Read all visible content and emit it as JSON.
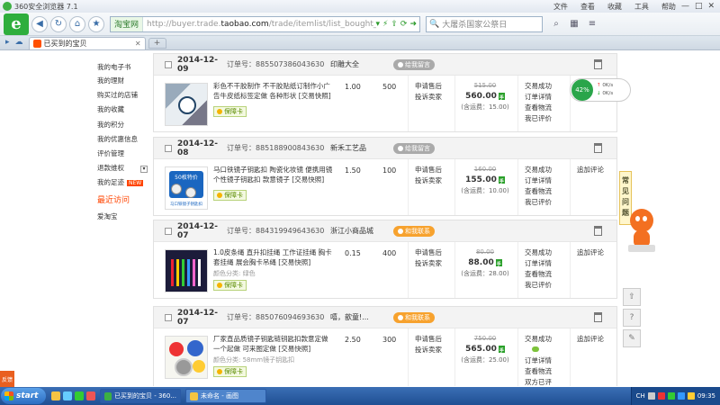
{
  "titlebar": {
    "app_title": "360安全浏览器 7.1",
    "menus": [
      "文件",
      "查看",
      "收藏",
      "工具",
      "帮助"
    ],
    "window_buttons": [
      "—",
      "□",
      "✕"
    ]
  },
  "navbar": {
    "address_tag": "淘宝网",
    "url_prefix": "http://buyer.trade.",
    "url_domain": "taobao.com",
    "url_rest": "/trade/itemlist/list_bought_items.htm?spm=a",
    "search_placeholder": "大屠杀国家公祭日"
  },
  "tabs": {
    "active_label": "已买到的宝贝",
    "close": "✕",
    "new_tab": "+"
  },
  "leftnav": {
    "items": [
      "我的电子书",
      "我的理财",
      "购买过的店铺",
      "我的收藏",
      "我的积分",
      "我的优惠信息",
      "评价管理",
      "退款维权",
      "我的足迹",
      "最近访问",
      "爱淘宝"
    ],
    "new_badge": "NEW",
    "expander": "▾"
  },
  "orders": [
    {
      "date": "2014-12-09",
      "order_no": "订单号：885507386043630",
      "shop": "印雕大全",
      "contact": "给我留言",
      "contact_on": false,
      "title": "彩色不干胶制作 不干胶贴纸订制作小广告牛皮纸标签定做 各种形状 [交易快照]",
      "meta": "",
      "badge": "保障卡",
      "price": "1.00",
      "qty": "500",
      "links": [
        "申请售后",
        "投诉卖家"
      ],
      "orig_price": "515.00",
      "total": "560.00",
      "shipping": "(含运费：15.00)",
      "status": [
        "交易成功",
        "订单详情",
        "查看物流",
        "我已评价"
      ],
      "action": ""
    },
    {
      "date": "2014-12-08",
      "order_no": "订单号：885188900843630",
      "shop": "新禾工艺品",
      "contact": "给我留言",
      "contact_on": false,
      "title": "马口铁镜子钥匙扣 陶瓷化妆镜 便携用镜 个性镜子钥匙扣 款意镜子 [交易快照]",
      "meta": "",
      "badge": "保障卡",
      "price": "1.50",
      "qty": "100",
      "links": [
        "申请售后",
        "投诉卖家"
      ],
      "orig_price": "160.00",
      "total": "155.00",
      "shipping": "(含运费：10.00)",
      "status": [
        "交易成功",
        "订单详情",
        "查看物流",
        "我已评价"
      ],
      "action": "追加评论"
    },
    {
      "date": "2014-12-07",
      "order_no": "订单号：884319949643630",
      "shop": "浙江小商品城",
      "contact": "和我联系",
      "contact_on": true,
      "title": "1.0皮条绳 直升扣挂绳 工作证挂绳 胸卡套挂绳 展会胸卡吊绳 [交易快照]",
      "meta": "颜色分类: 绿色",
      "badge": "保障卡",
      "price": "0.15",
      "qty": "400",
      "links": [
        "申请售后",
        "投诉卖家"
      ],
      "orig_price": "80.00",
      "total": "88.00",
      "shipping": "(含运费：28.00)",
      "status": [
        "交易成功",
        "订单详情",
        "查看物流",
        "我已评价"
      ],
      "action": "追加评论"
    },
    {
      "date": "2014-12-07",
      "order_no": "订单号：885076094693630",
      "shop": "嘻，歆童!...",
      "contact": "和我联系",
      "contact_on": true,
      "title": "厂家直品质镜子钥匙链钥匙扣款意定做 一个起做 可来图定做 [交易快照]",
      "meta": "颜色分类: 58mm镜子钥匙扣",
      "badge": "保障卡",
      "price": "2.50",
      "qty": "300",
      "links": [
        "申请售后",
        "投诉卖家"
      ],
      "orig_price": "750.00",
      "total": "565.00",
      "shipping": "(含运费：25.00)",
      "status": [
        "交易成功",
        "订单详情",
        "查看物流",
        "双方已评"
      ],
      "action": "追加评论"
    }
  ],
  "speed_widget": {
    "percent": "42%",
    "up": "0K/s",
    "down": "0K/s"
  },
  "faq_label": "常见问题",
  "feedback_label": "反馈",
  "taskbar": {
    "start": "start",
    "tasks": [
      "已买到的宝贝 - 360...",
      "未命名 - 画图"
    ],
    "lang": "CH",
    "clock": "09:35"
  }
}
